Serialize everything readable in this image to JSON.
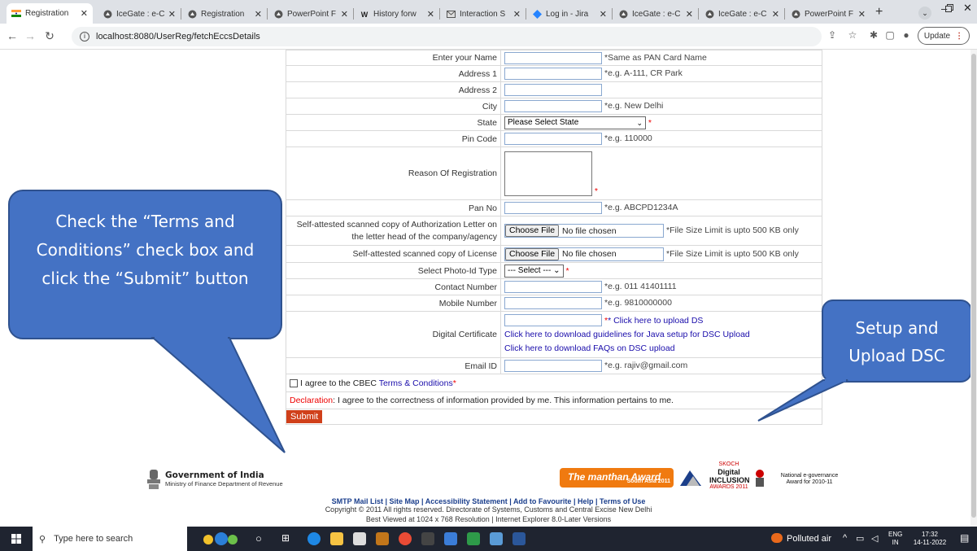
{
  "browser": {
    "tabs": [
      {
        "title": "Registration",
        "icon": "india-flag-icon",
        "active": true
      },
      {
        "title": "IceGate : e-C",
        "icon": "icegate-icon"
      },
      {
        "title": "Registration",
        "icon": "icegate-icon"
      },
      {
        "title": "PowerPoint F",
        "icon": "icegate-icon"
      },
      {
        "title": "History forw",
        "icon": "w-icon"
      },
      {
        "title": "Interaction S",
        "icon": "mail-icon"
      },
      {
        "title": "Log in - Jira",
        "icon": "jira-icon"
      },
      {
        "title": "IceGate : e-C",
        "icon": "icegate-icon"
      },
      {
        "title": "IceGate : e-C",
        "icon": "icegate-icon"
      },
      {
        "title": "PowerPoint F",
        "icon": "icegate-icon"
      }
    ],
    "url": "localhost:8080/UserReg/fetchEccsDetails",
    "update_label": "Update"
  },
  "form": {
    "rows": [
      {
        "label": "Enter your Name",
        "hint": "*Same as PAN Card Name"
      },
      {
        "label": "Address 1",
        "hint": "*e.g. A-111, CR Park"
      },
      {
        "label": "Address 2",
        "hint": ""
      },
      {
        "label": "City",
        "hint": "*e.g. New Delhi"
      },
      {
        "label": "State",
        "select": "Please Select State",
        "hint": "*"
      },
      {
        "label": "Pin Code",
        "hint": "*e.g. 110000"
      },
      {
        "label": "Reason Of Registration",
        "hint": "*"
      },
      {
        "label": "Pan No",
        "hint": "*e.g. ABCPD1234A"
      },
      {
        "label": "Self-attested scanned copy of Authorization Letter on the letter head of the company/agency",
        "file_button": "Choose File",
        "file_status": "No file chosen",
        "hint": "*File Size Limit is upto 500 KB only"
      },
      {
        "label": "Self-attested scanned copy of License",
        "file_button": "Choose File",
        "file_status": "No file chosen",
        "hint": "*File Size Limit is upto 500 KB only"
      },
      {
        "label": "Select Photo-Id Type",
        "select": "--- Select ---",
        "hint": "*"
      },
      {
        "label": "Contact Number",
        "hint": "*e.g. 011 41401111"
      },
      {
        "label": "Mobile Number",
        "hint": "*e.g. 9810000000"
      },
      {
        "label": "Digital Certificate",
        "hint": "* Click here to upload DS",
        "link1": "Click here to download guidelines for Java setup for DSC Upload",
        "link2": "Click here to download FAQs on DSC upload"
      },
      {
        "label": "Email ID",
        "hint": "*e.g. rajiv@gmail.com"
      }
    ],
    "agree_text": "I agree to the CBEC",
    "terms_link": "Terms & Conditions",
    "terms_star": "*",
    "declaration_label": "Declaration",
    "declaration_text": ": I agree to the correctness of information provided by me. This information pertains to me.",
    "submit_label": "Submit"
  },
  "callouts": {
    "left": "Check the “Terms and Conditions” check box and click the “Submit” button",
    "right": "Setup and Upload DSC"
  },
  "footer": {
    "gov_title": "Government of India",
    "gov_subtitle": "Ministry of Finance Department of Revenue",
    "award1": "The manthan Award",
    "award1_sub": "South Asia 2011",
    "award2": "Digital INCLUSION",
    "award2_top": "SKOCH",
    "award2_sub": "AWARDS 2011",
    "award3": "National e-governance Award for 2010-11",
    "links": [
      "SMTP Mail List",
      "Site Map",
      "Accessibility Statement",
      "Add to Favourite",
      "Help",
      "Terms of Use"
    ],
    "copyright": "Copyright © 2011 All rights reserved. Directorate of Systems, Customs and Central Excise New Delhi",
    "best_viewed": "Best Viewed at 1024 x 768 Resolution | Internet Explorer 8.0-Later Versions"
  },
  "taskbar": {
    "search_placeholder": "Type here to search",
    "weather": "Polluted air",
    "lang": "ENG",
    "region": "IN",
    "time": "17:32",
    "date": "14-11-2022"
  },
  "colors": {
    "callout": "#4472c4",
    "submit": "#d0401a",
    "link": "#1a0dab"
  }
}
